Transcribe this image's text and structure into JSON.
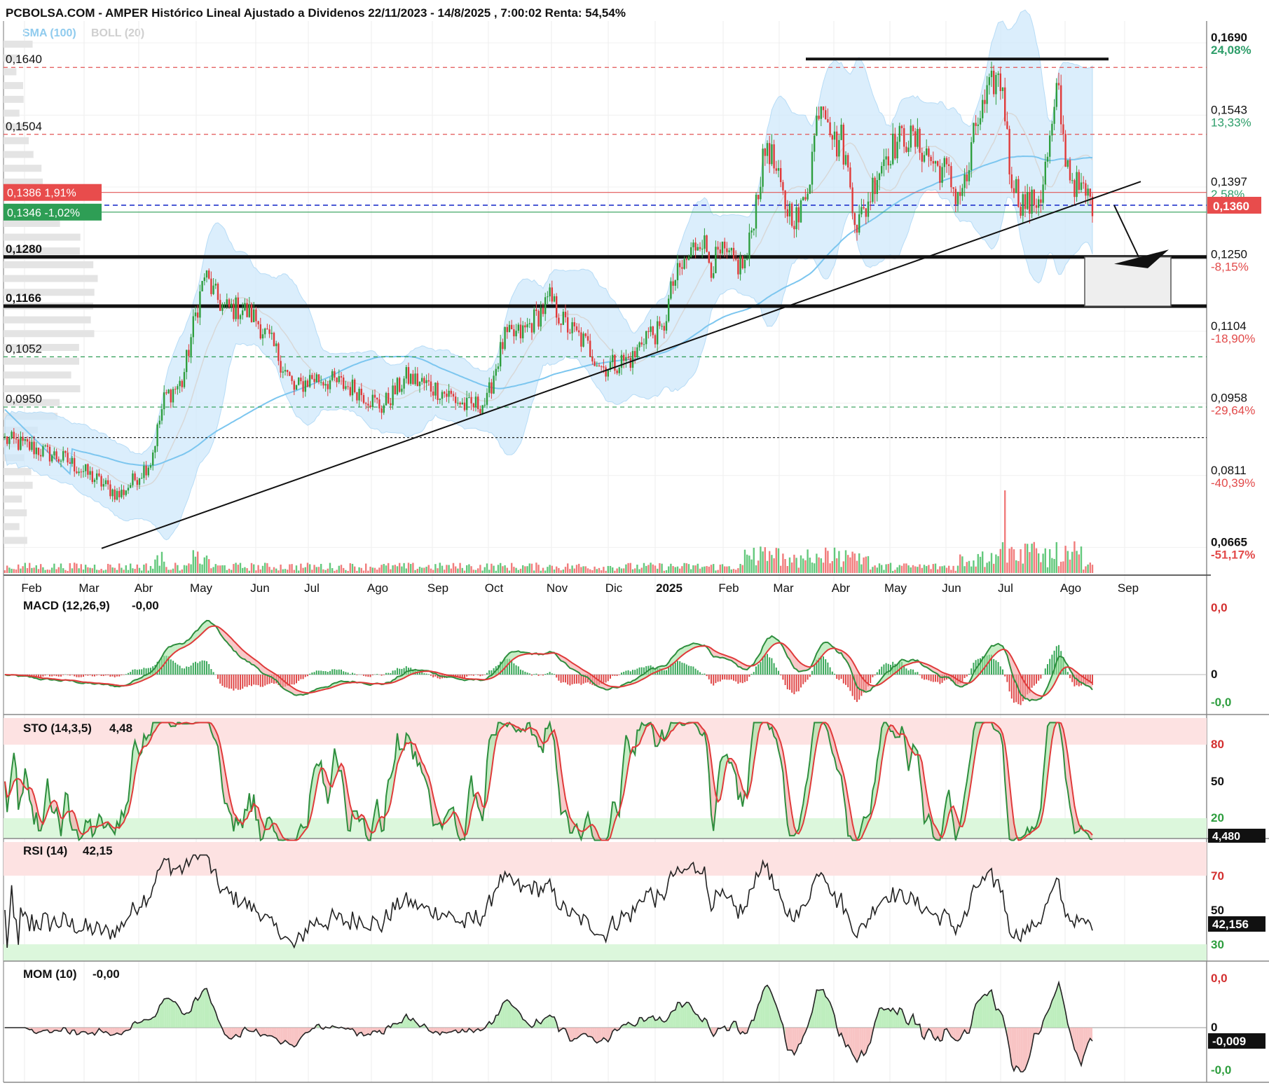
{
  "header": {
    "title": "PCBOLSA.COM - AMPER Histórico Lineal Ajustado a Dividenos 22/11/2023 - 14/8/2025 , 7:00:02 Renta: 54,54%",
    "sma_label": "SMA (100)",
    "boll_label": "BOLL (20)"
  },
  "colors": {
    "up": "#2e9e3e",
    "down": "#e03a3a",
    "sma": "#7cc6ef",
    "boll_fill": "#cfe8fb",
    "resistance_pct": "#e24a4a",
    "support_pct": "#2e9e6a"
  },
  "price_axis": {
    "labels": [
      {
        "price": 0.169,
        "text": "0,1690",
        "pct": "24,08%",
        "pct_color": "green"
      },
      {
        "price": 0.1543,
        "text": "0,1543",
        "pct": "13,33%",
        "pct_color": "green"
      },
      {
        "price": 0.1397,
        "text": "0,1397",
        "pct": "2,58%",
        "pct_color": "green"
      },
      {
        "price": 0.125,
        "text": "0,1250",
        "pct": "-8,15%",
        "pct_color": "red"
      },
      {
        "price": 0.1104,
        "text": "0,1104",
        "pct": "-18,90%",
        "pct_color": "red"
      },
      {
        "price": 0.0958,
        "text": "0,0958",
        "pct": "-29,64%",
        "pct_color": "red"
      },
      {
        "price": 0.0811,
        "text": "0,0811",
        "pct": "-40,39%",
        "pct_color": "red"
      },
      {
        "price": 0.0665,
        "text": "0,0665",
        "pct": "-51,17%",
        "pct_color": "red"
      }
    ],
    "current_price": "0,1360"
  },
  "level_labels": [
    {
      "price": 0.164,
      "text": "0,1640",
      "style": "red-dash"
    },
    {
      "price": 0.1504,
      "text": "0,1504",
      "style": "red-dash"
    },
    {
      "price": 0.1386,
      "text": "0,1386  1,91%",
      "style": "red-box"
    },
    {
      "price": 0.1346,
      "text": "0,1346  -1,02%",
      "style": "green-box"
    },
    {
      "price": 0.1255,
      "text": "0,1280",
      "style": "bold-black"
    },
    {
      "price": 0.1155,
      "text": "0,1166",
      "style": "bold-black"
    },
    {
      "price": 0.1052,
      "text": "0,1052",
      "style": "green-dash"
    },
    {
      "price": 0.095,
      "text": "0,0950",
      "style": "green-dash"
    }
  ],
  "months": [
    "Feb",
    "Mar",
    "Abr",
    "May",
    "Jun",
    "Jul",
    "Ago",
    "Sep",
    "Oct",
    "Nov",
    "Dic",
    "2025",
    "Feb",
    "Mar",
    "Abr",
    "May",
    "Jun",
    "Jul",
    "Ago",
    "Sep"
  ],
  "indicators": {
    "macd": {
      "label": "MACD (12,26,9)",
      "value": "-0,00",
      "ticks": [
        "0,0",
        "0",
        "-0,0"
      ]
    },
    "sto": {
      "label": "STO (14,3,5)",
      "value": "4,48",
      "ticks": [
        "80",
        "50",
        "20"
      ],
      "box": "4,480"
    },
    "rsi": {
      "label": "RSI (14)",
      "value": "42,15",
      "ticks": [
        "70",
        "50",
        "30"
      ],
      "box": "42,156"
    },
    "mom": {
      "label": "MOM (10)",
      "value": "-0,00",
      "ticks": [
        "0,0",
        "0",
        "-0,0"
      ],
      "box": "-0,009"
    }
  },
  "chart_data": {
    "type": "candlestick",
    "title": "PCBOLSA.COM - AMPER Histórico Lineal Ajustado a Dividenos 22/11/2023 - 14/8/2025 , 7:00:02 Renta: 54,54%",
    "x_axis_months": [
      "Feb",
      "Mar",
      "Abr",
      "May",
      "Jun",
      "Jul",
      "Ago",
      "Sep",
      "Oct",
      "Nov",
      "Dic",
      "2025",
      "Feb",
      "Mar",
      "Abr",
      "May",
      "Jun",
      "Jul",
      "Ago",
      "Sep"
    ],
    "ylim": [
      0.061,
      0.172
    ],
    "approx_close_by_month": [
      {
        "month": "Feb 2024",
        "close": 0.087
      },
      {
        "month": "Mar 2024",
        "close": 0.078
      },
      {
        "month": "Abr 2024",
        "close": 0.097
      },
      {
        "month": "May 2024",
        "close": 0.122
      },
      {
        "month": "Jun 2024",
        "close": 0.112
      },
      {
        "month": "Jul 2024",
        "close": 0.099
      },
      {
        "month": "Ago 2024",
        "close": 0.097
      },
      {
        "month": "Sep 2024",
        "close": 0.094
      },
      {
        "month": "Oct 2024",
        "close": 0.113
      },
      {
        "month": "Nov 2024",
        "close": 0.11
      },
      {
        "month": "Dic 2024",
        "close": 0.106
      },
      {
        "month": "Ene 2025",
        "close": 0.125
      },
      {
        "month": "Feb 2025",
        "close": 0.123
      },
      {
        "month": "Mar 2025",
        "close": 0.138
      },
      {
        "month": "Abr 2025",
        "close": 0.141
      },
      {
        "month": "May 2025",
        "close": 0.146
      },
      {
        "month": "Jun 2025",
        "close": 0.152
      },
      {
        "month": "Jul 2025",
        "close": 0.156
      },
      {
        "month": "Ago 2025",
        "close": 0.136
      }
    ],
    "last_price": 0.136,
    "horizontal_levels": [
      0.164,
      0.1504,
      0.1386,
      0.1346,
      0.1255,
      0.1155,
      0.1052,
      0.095
    ],
    "series": [
      {
        "name": "SMA (100)"
      },
      {
        "name": "BOLL (20)"
      }
    ]
  }
}
